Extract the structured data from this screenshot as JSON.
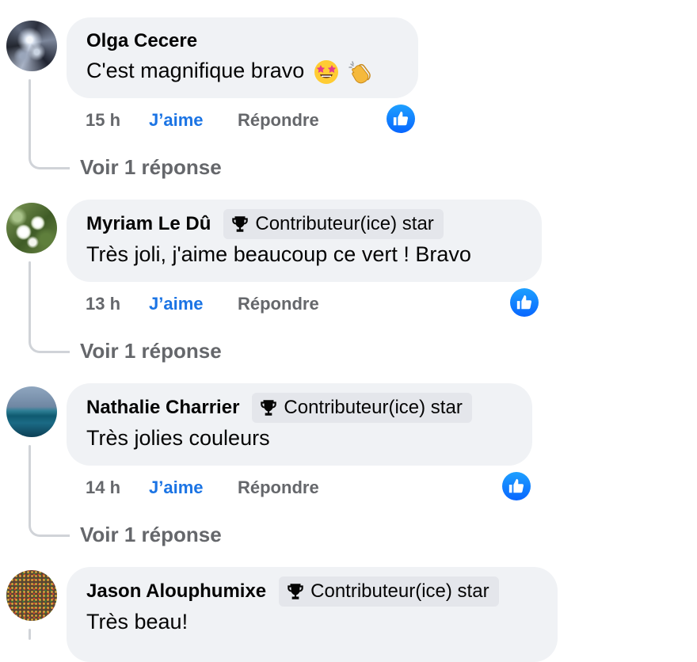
{
  "comments": [
    {
      "author": "Olga Cecere",
      "badge": "",
      "text": "C'est magnifique bravo",
      "emojis": [
        "star-struck-emoji",
        "clapping-hands-emoji"
      ],
      "time": "15 h",
      "like_label": "J’aime",
      "reply_label": "Répondre",
      "reaction": "like-reaction-icon",
      "replies_label": "Voir 1 réponse"
    },
    {
      "author": "Myriam Le Dû",
      "badge": "Contributeur(ice) star",
      "text": "Très joli, j'aime beaucoup ce vert ! Bravo",
      "time": "13 h",
      "like_label": "J’aime",
      "reply_label": "Répondre",
      "reaction": "like-reaction-icon",
      "replies_label": "Voir 1 réponse"
    },
    {
      "author": "Nathalie Charrier",
      "badge": "Contributeur(ice) star",
      "text": "Très jolies couleurs",
      "time": "14 h",
      "like_label": "J’aime",
      "reply_label": "Répondre",
      "reaction": "like-reaction-icon",
      "replies_label": "Voir 1 réponse"
    },
    {
      "author": "Jason Alouphumixe",
      "badge": "Contributeur(ice) star",
      "text": "Très beau!"
    }
  ],
  "colors": {
    "bubble": "#f0f2f5",
    "badge": "#e4e6eb",
    "like_active": "#1b74e4",
    "secondary_text": "#65676b",
    "thread_line": "#d0d3d8"
  }
}
